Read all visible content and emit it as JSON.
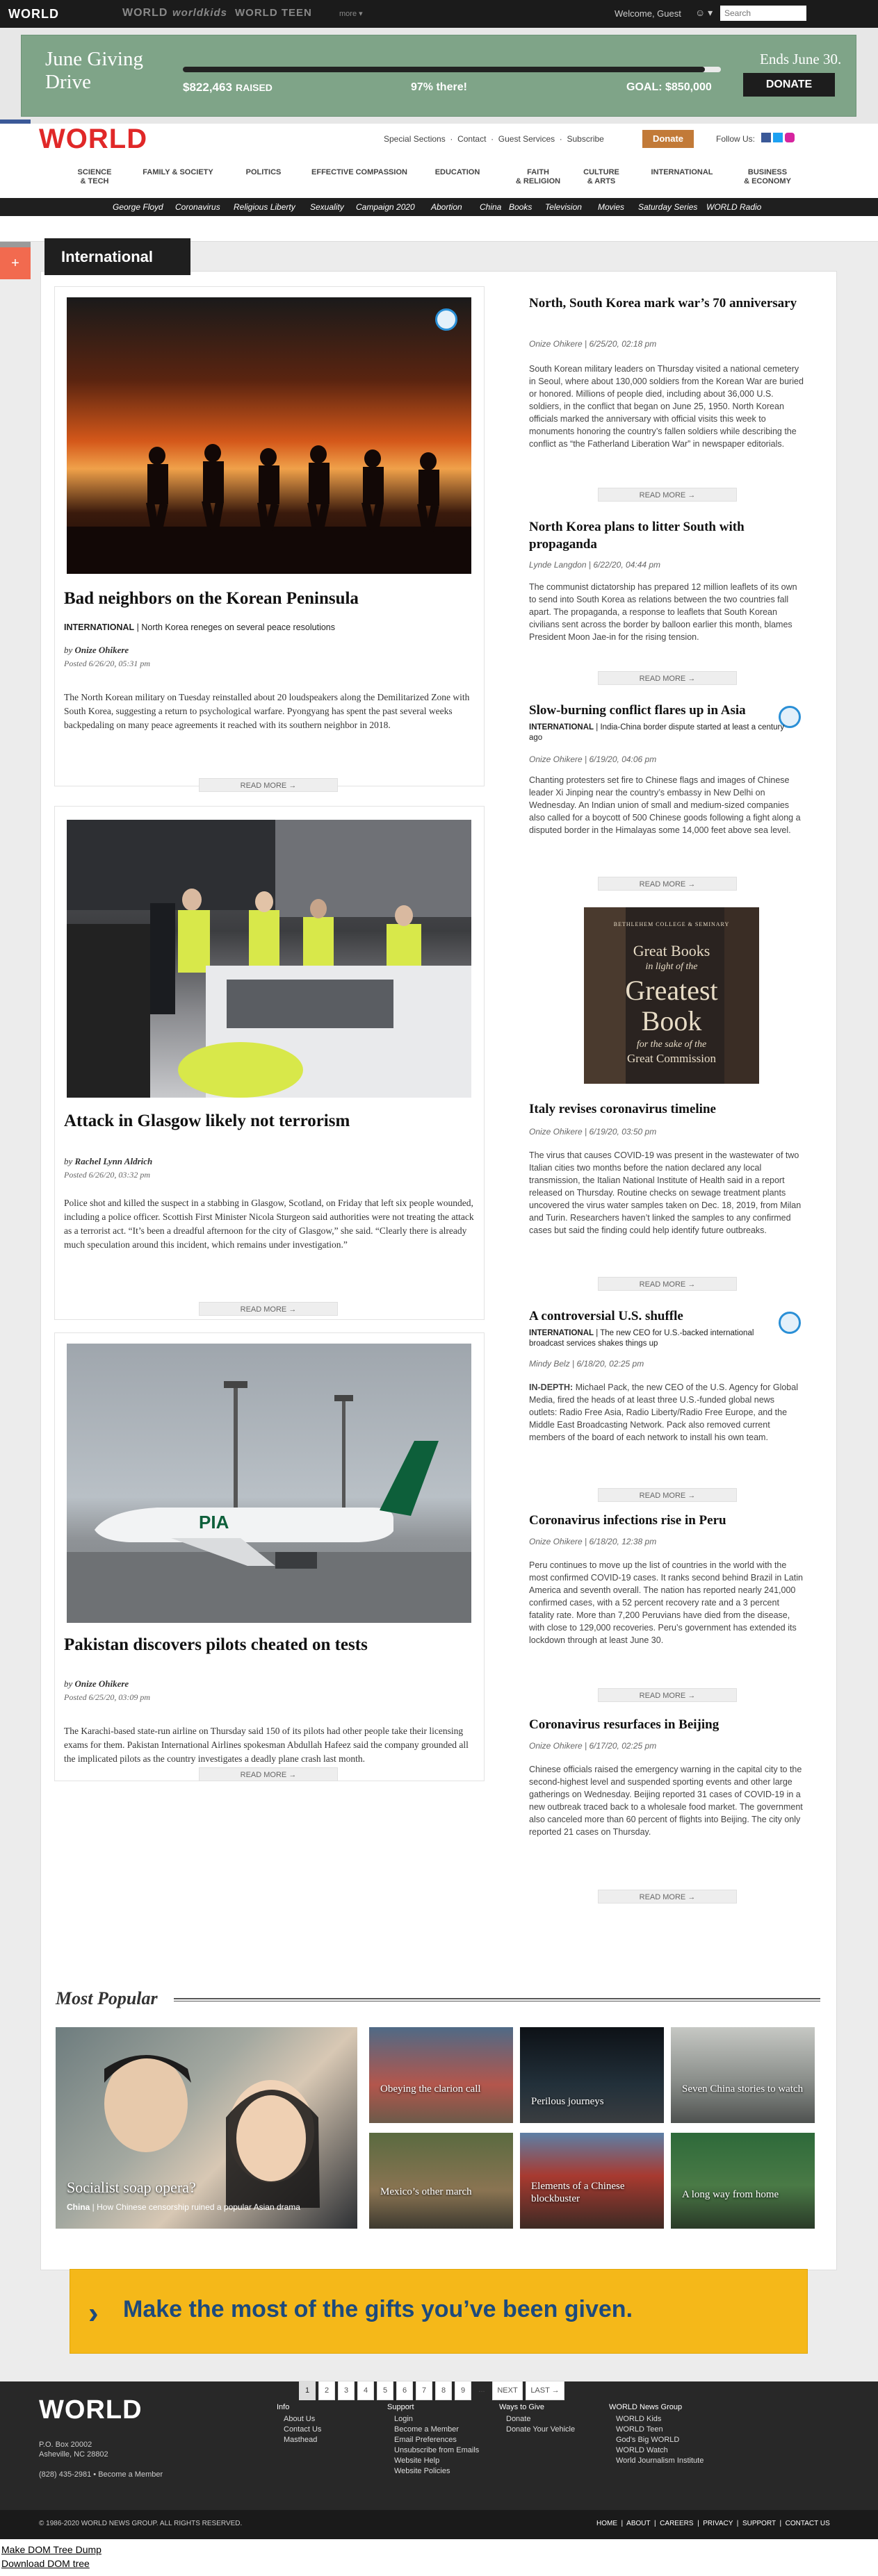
{
  "topbar": {
    "logo": "WORLD",
    "sublogos": [
      "WORLD",
      "worldkids",
      "WORLD TEEN"
    ],
    "more": "more ▾",
    "welcome": "Welcome, Guest",
    "user_icon": "person-icon",
    "search_placeholder": "Search"
  },
  "giving": {
    "title_line1": "June Giving",
    "title_line2": "Drive",
    "raised_amount": "$822,463",
    "raised_label": "RAISED",
    "progress_pct": 97,
    "progress_text": "97% there!",
    "goal_label": "GOAL:",
    "goal_amount": "$850,000",
    "ends": "Ends June 30.",
    "donate": "DONATE"
  },
  "header": {
    "logo": "WORLD",
    "links": [
      "Special Sections",
      "Contact",
      "Guest Services",
      "Subscribe"
    ],
    "donate": "Donate",
    "follow": "Follow Us:"
  },
  "nav": [
    {
      "l1": "SCIENCE",
      "l2": "& TECH"
    },
    {
      "l1": "FAMILY & SOCIETY",
      "l2": ""
    },
    {
      "l1": "POLITICS",
      "l2": ""
    },
    {
      "l1": "EFFECTIVE COMPASSION",
      "l2": ""
    },
    {
      "l1": "EDUCATION",
      "l2": ""
    },
    {
      "l1": "FAITH",
      "l2": "& RELIGION"
    },
    {
      "l1": "CULTURE",
      "l2": "& ARTS"
    },
    {
      "l1": "INTERNATIONAL",
      "l2": ""
    },
    {
      "l1": "BUSINESS",
      "l2": "& ECONOMY"
    }
  ],
  "trending": [
    "George Floyd",
    "Coronavirus",
    "Religious Liberty",
    "Sexuality",
    "Campaign 2020",
    "Abortion",
    "China",
    "Books",
    "Television",
    "Movies",
    "Saturday Series",
    "WORLD Radio"
  ],
  "section_title": "International",
  "left_articles": [
    {
      "title": "Bad neighbors on the Korean Peninsula",
      "category": "INTERNATIONAL",
      "deck": "North Korea reneges on several peace resolutions",
      "byline_prefix": "by",
      "author": "Onize Ohikere",
      "posted": "Posted 6/26/20, 05:31 pm",
      "body": "The North Korean military on Tuesday reinstalled about 20 loudspeakers along the Demilitarized Zone with South Korea, suggesting a return to psychological warfare. Pyongyang has spent the past several weeks backpedaling on many peace agreements it reached with its southern neighbor in 2018.",
      "read_more": "READ MORE →"
    },
    {
      "title": "Attack in Glasgow likely not terrorism",
      "byline_prefix": "by",
      "author": "Rachel Lynn Aldrich",
      "posted": "Posted 6/26/20, 03:32 pm",
      "body": "Police shot and killed the suspect in a stabbing in Glasgow, Scotland, on Friday that left six people wounded, including a police officer. Scottish First Minister Nicola Sturgeon said authorities were not treating the attack as a terrorist act. “It’s been a dreadful afternoon for the city of Glasgow,” she said. “Clearly there is already much speculation around this incident, which remains under investigation.”",
      "read_more": "READ MORE →"
    },
    {
      "title": "Pakistan discovers pilots cheated on tests",
      "byline_prefix": "by",
      "author": "Onize Ohikere",
      "posted": "Posted 6/25/20, 03:09 pm",
      "body": "The Karachi-based state-run airline on Thursday said 150 of its pilots had other people take their licensing exams for them. Pakistan International Airlines spokesman Abdullah Hafeez said the company grounded all the implicated pilots as the country investigates a deadly plane crash last month.",
      "read_more": "READ MORE →"
    }
  ],
  "right_articles": [
    {
      "title": "North, South Korea mark war’s 70 anniversary",
      "meta": "Onize Ohikere | 6/25/20, 02:18 pm",
      "body": "South Korean military leaders on Thursday visited a national cemetery in Seoul, where about 130,000 soldiers from the Korean War are buried or honored. Millions of people died, including about 36,000 U.S. soldiers, in the conflict that began on June 25, 1950. North Korean officials marked the anniversary with official visits this week to monuments honoring the country’s fallen soldiers while describing the conflict as “the Fatherland Liberation War” in newspaper editorials.",
      "read_more": "READ MORE →"
    },
    {
      "title": "North Korea plans to litter South with propaganda",
      "meta": "Lynde Langdon | 6/22/20, 04:44 pm",
      "body": "The communist dictatorship has prepared 12 million leaflets of its own to send into South Korea as relations between the two countries fall apart. The propaganda, a response to leaflets that South Korean civilians sent across the border by balloon earlier this month, blames President Moon Jae-in for the rising tension.",
      "read_more": "READ MORE →"
    },
    {
      "title": "Slow-burning conflict flares up in Asia",
      "category": "INTERNATIONAL",
      "deck": "India-China border dispute started at least a century ago",
      "meta": "Onize Ohikere | 6/19/20, 04:06 pm",
      "body": "Chanting protesters set fire to Chinese flags and images of Chinese leader Xi Jinping near the country’s embassy in New Delhi on Wednesday. An Indian union of small and medium-sized companies also called for a boycott of 500 Chinese goods following a fight along a disputed border in the Himalayas some 14,000 feet above sea level.",
      "read_more": "READ MORE →"
    },
    {
      "title": "Italy revises coronavirus timeline",
      "meta": "Onize Ohikere | 6/19/20, 03:50 pm",
      "body": "The virus that causes COVID-19 was present in the wastewater of two Italian cities two months before the nation declared any local transmission, the Italian National Institute of Health said in a report released on Thursday. Routine checks on sewage treatment plants uncovered the virus water samples taken on Dec. 18, 2019, from Milan and Turin. Researchers haven’t linked the samples to any confirmed cases but said the finding could help identify future outbreaks.",
      "read_more": "READ MORE →"
    },
    {
      "title": "A controversial U.S. shuffle",
      "category": "INTERNATIONAL",
      "deck": "The new CEO for U.S.-backed international broadcast services shakes things up",
      "meta": "Mindy Belz | 6/18/20, 02:25 pm",
      "indepth": "IN-DEPTH:",
      "body": "Michael Pack, the new CEO of the U.S. Agency for Global Media, fired the heads of at least three U.S.-funded global news outlets: Radio Free Asia, Radio Liberty/Radio Free Europe, and the Middle East Broadcasting Network. Pack also removed current members of the board of each network to install his own team.",
      "read_more": "READ MORE →"
    },
    {
      "title": "Coronavirus infections rise in Peru",
      "meta": "Onize Ohikere | 6/18/20, 12:38 pm",
      "body": "Peru continues to move up the list of countries in the world with the most confirmed COVID-19 cases. It ranks second behind Brazil in Latin America and seventh overall. The nation has reported nearly 241,000 confirmed cases, with a 52 percent recovery rate and a 3 percent fatality rate. More than 7,200 Peruvians have died from the disease, with close to 129,000 recoveries. Peru’s government has extended its lockdown through at least June 30.",
      "read_more": "READ MORE →"
    },
    {
      "title": "Coronavirus resurfaces in Beijing",
      "meta": "Onize Ohikere | 6/17/20, 02:25 pm",
      "body": "Chinese officials raised the emergency warning in the capital city to the second-highest level and suspended sporting events and other large gatherings on Wednesday. Beijing reported 31 cases of COVID-19 in a new outbreak traced back to a wholesale food market. The government also canceled more than 60 percent of flights into Beijing. The city only reported 21 cases on Thursday.",
      "read_more": "READ MORE →"
    }
  ],
  "ad": {
    "line1": "BETHLEHEM COLLEGE & SEMINARY",
    "line2": "Great Books",
    "line3": "in light of the",
    "line4": "Greatest",
    "line5": "Book",
    "line6": "for the sake of the",
    "line7": "Great Commission"
  },
  "pagination": {
    "pages": [
      "1",
      "2",
      "3",
      "4",
      "5",
      "6",
      "7",
      "8",
      "9"
    ],
    "ellipsis": "...",
    "next": "NEXT",
    "last": "LAST →"
  },
  "most_popular": {
    "title": "Most Popular",
    "main_title": "Socialist soap opera?",
    "main_category": "China",
    "main_deck": "How Chinese censorship ruined a popular Asian drama",
    "items": [
      "Obeying the clarion call",
      "Perilous journeys",
      "Seven China stories to watch",
      "Mexico’s other march",
      "Elements of a Chinese blockbuster",
      "A long way from home"
    ]
  },
  "banner": {
    "text": "Make the most of the gifts you’ve been given."
  },
  "footer": {
    "logo": "WORLD",
    "address1": "P.O. Box 20002",
    "address2": "Asheville, NC 28802",
    "phone": "(828) 435-2981",
    "member": "Become a Member",
    "cols": [
      {
        "title": "Info",
        "items": [
          "About Us",
          "Contact Us",
          "Masthead"
        ]
      },
      {
        "title": "Support",
        "items": [
          "Login",
          "Become a Member",
          "Email Preferences",
          "Unsubscribe from Emails",
          "Website Help",
          "Website Policies"
        ]
      },
      {
        "title": "Ways to Give",
        "items": [
          "Donate",
          "Donate Your Vehicle"
        ]
      },
      {
        "title": "WORLD News Group",
        "items": [
          "WORLD Kids",
          "WORLD Teen",
          "God's Big WORLD",
          "WORLD Watch",
          "World Journalism Institute"
        ]
      }
    ],
    "copyright": "© 1986-2020 WORLD NEWS GROUP. ALL RIGHTS RESERVED.",
    "bottom_links": [
      "HOME",
      "ABOUT",
      "CAREERS",
      "PRIVACY",
      "SUPPORT",
      "CONTACT US"
    ]
  },
  "dev_links": [
    "Make DOM Tree Dump",
    "Download DOM tree"
  ]
}
